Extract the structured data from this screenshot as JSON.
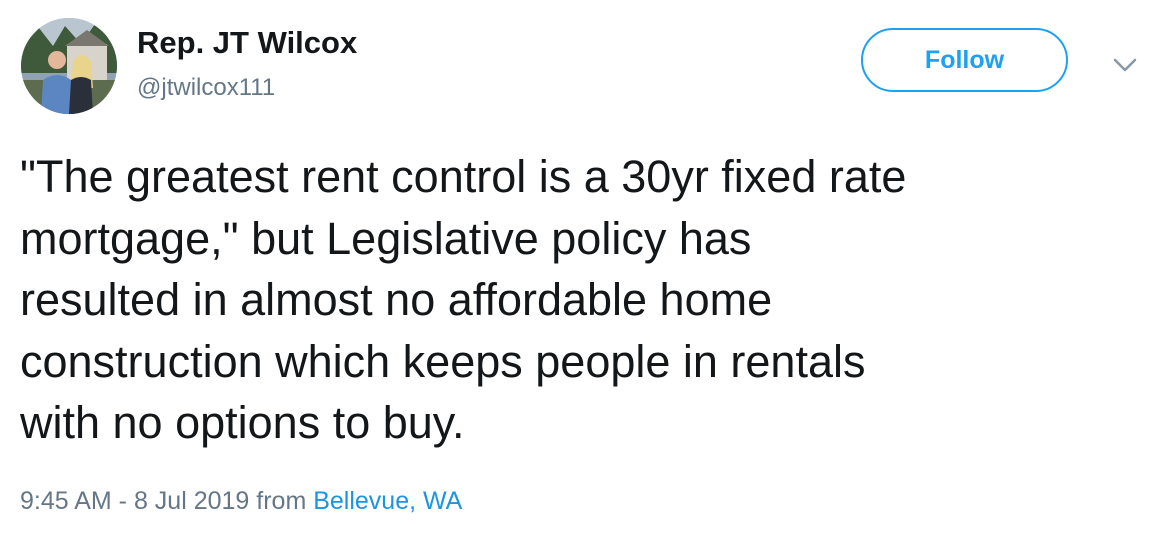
{
  "author": {
    "display_name": "Rep. JT Wilcox",
    "handle": "@jtwilcox111",
    "avatar_icon": "profile-photo"
  },
  "actions": {
    "follow_label": "Follow",
    "more_icon": "chevron-down-icon"
  },
  "tweet": {
    "text": "\"The greatest rent control is a 30yr fixed rate\nmortgage,\" but Legislative policy has\nresulted in almost no affordable home\nconstruction which keeps people in rentals\nwith no options to buy.",
    "timestamp": "9:45 AM - 8 Jul 2019",
    "from_label": "from",
    "location": "Bellevue, WA"
  },
  "colors": {
    "accent": "#1da1f2",
    "link": "#1b95e0",
    "secondary_text": "#657786",
    "primary_text": "#14171a"
  }
}
